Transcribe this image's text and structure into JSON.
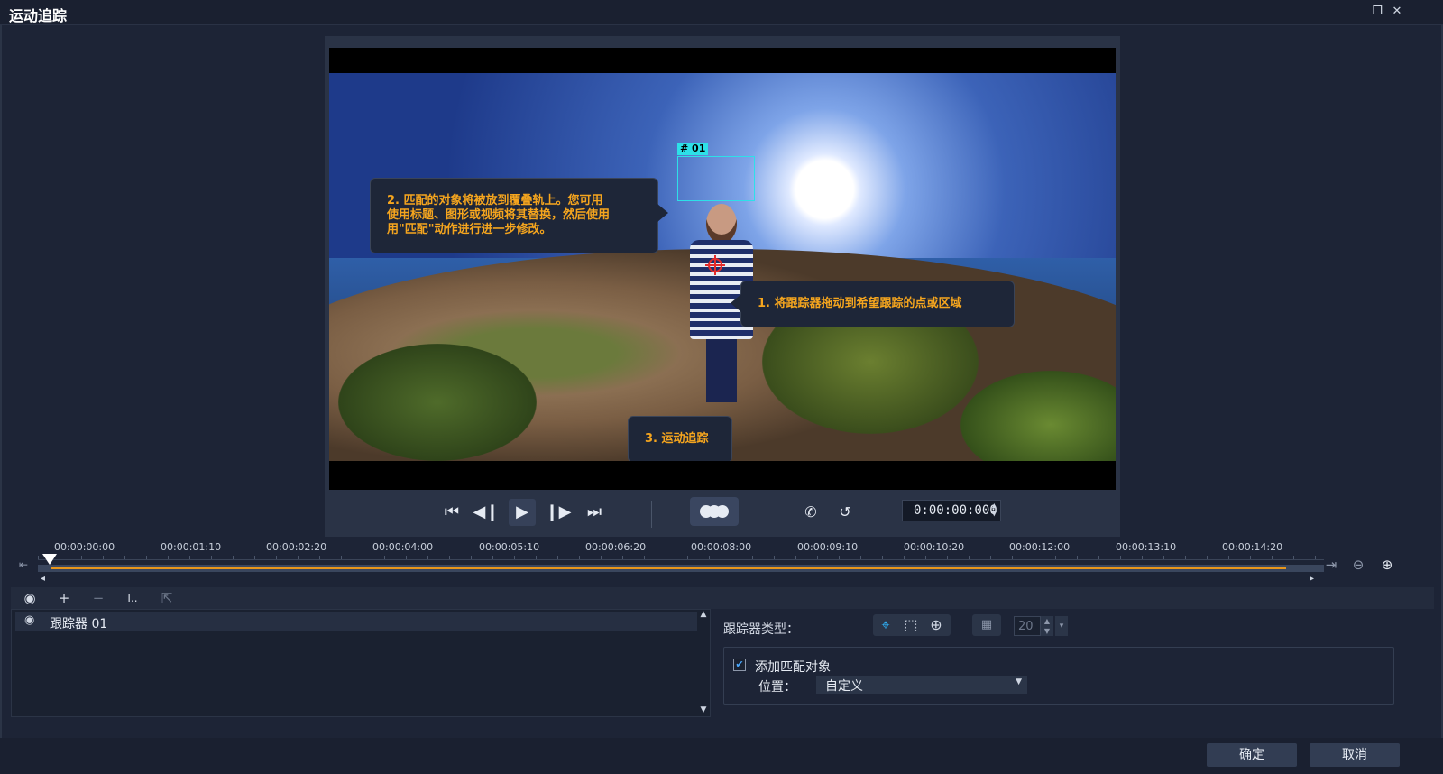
{
  "window": {
    "title": "运动追踪",
    "restore_icon": "restore-icon",
    "close_icon": "close-icon"
  },
  "preview": {
    "tracker_tag": "# 01",
    "callout_1": "1. 将跟踪器拖动到希望跟踪的点或区域",
    "callout_2_lines": [
      "2. 匹配的对象将被放到覆叠轨上。您可用",
      "使用标题、图形或视频将其替换，然后使用",
      "用\"匹配\"动作进行进一步修改。"
    ],
    "callout_3": "3. 运动追踪"
  },
  "controls": {
    "timecode": "0:00:00:000",
    "buttons": [
      "go-to-start-icon",
      "previous-frame-icon",
      "play-icon",
      "next-frame-icon",
      "go-to-end-icon",
      "motion-track-icon",
      "phone-icon",
      "history-icon"
    ]
  },
  "timeline": {
    "ticks": [
      "00:00:00:00",
      "00:00:01:10",
      "00:00:02:20",
      "00:00:04:00",
      "00:00:05:10",
      "00:00:06:20",
      "00:00:08:00",
      "00:00:09:10",
      "00:00:10:20",
      "00:00:12:00",
      "00:00:13:10",
      "00:00:14:20"
    ],
    "playhead_fraction": 0.0,
    "progress_fraction": 0.97
  },
  "tracker_list": {
    "items": [
      {
        "label": "跟踪器 01"
      }
    ]
  },
  "properties": {
    "tracker_type_label": "跟踪器类型：",
    "size_value": "20",
    "add_match_label": "添加匹配对象",
    "add_match_checked": true,
    "position_label": "位置：",
    "position_value": "自定义"
  },
  "footer": {
    "ok_label": "确定",
    "cancel_label": "取消"
  },
  "colors": {
    "accent_orange": "#f5a51e",
    "tracker_cyan": "#2de0e8",
    "tracker_red": "#e32b2b",
    "timeline_fill": "#e8961b",
    "active_blue": "#2fb6ff"
  }
}
